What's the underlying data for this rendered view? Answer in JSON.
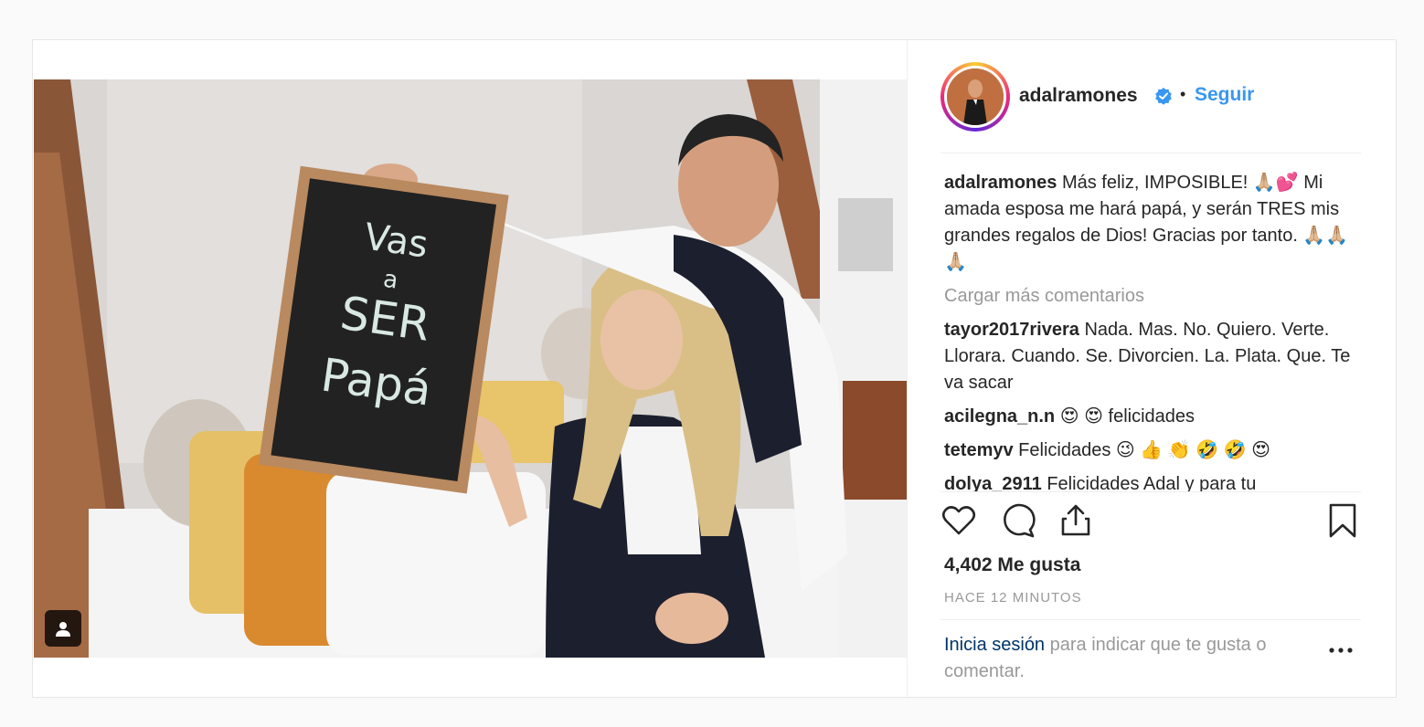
{
  "post": {
    "username": "adalramones",
    "separator": "•",
    "follow_label": "Seguir",
    "caption": {
      "username": "adalramones",
      "text": "Más feliz, IMPOSIBLE! 🙏🏼💕 Mi amada esposa me hará papá, y serán TRES mis grandes regalos de Dios! Gracias por tanto. 🙏🏼🙏🏼🙏🏼"
    },
    "load_more_label": "Cargar más comentarios",
    "comments": [
      {
        "username": "tayor2017rivera",
        "text": "Nada. Mas. No. Quiero. Verte. Llorara. Cuando. Se. Divorcien. La. Plata. Que. Te va sacar"
      },
      {
        "username": "acilegna_n.n",
        "text": "😍 😍 felicidades"
      },
      {
        "username": "tetemyv",
        "text": "Felicidades 😉 👍 👏 🤣 🤣 😍"
      },
      {
        "username": "dolya_2911",
        "text": "Felicidades Adal y para tu"
      }
    ],
    "likes_label": "4,402 Me gusta",
    "time_label": "HACE 12 MINUTOS",
    "login_link": "Inicia sesión",
    "login_text": " para indicar que te gusta o comentar.",
    "chalkboard": {
      "line1": "Vas",
      "line2": "a",
      "line3": "SER",
      "line4": "Papá"
    },
    "icons": {
      "verified": "verified-badge-icon",
      "like": "heart-icon",
      "comment": "comment-bubble-icon",
      "share": "share-icon",
      "save": "bookmark-icon",
      "more": "more-options-icon",
      "tagged": "tagged-user-icon"
    },
    "colors": {
      "link": "#3897f0",
      "login_link": "#003569",
      "muted": "#999999"
    }
  }
}
